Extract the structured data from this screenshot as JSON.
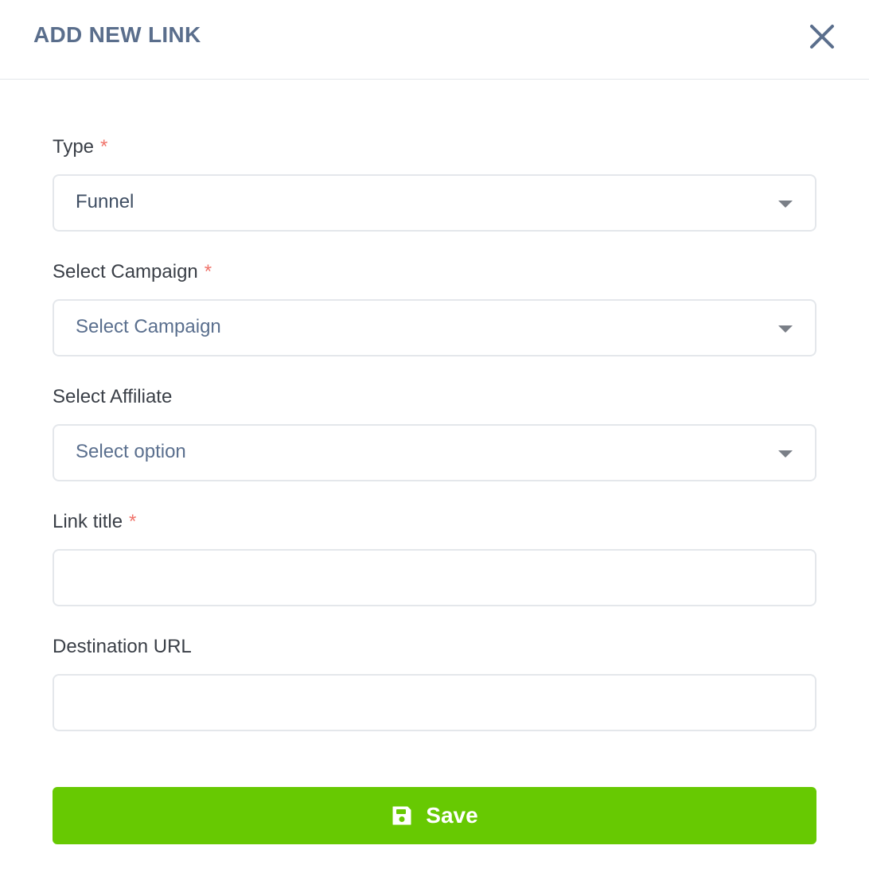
{
  "header": {
    "title": "ADD NEW LINK",
    "close_icon": "close-icon"
  },
  "form": {
    "type": {
      "label": "Type",
      "required_mark": "*",
      "value": "Funnel"
    },
    "campaign": {
      "label": "Select Campaign",
      "required_mark": "*",
      "placeholder": "Select Campaign"
    },
    "affiliate": {
      "label": "Select Affiliate",
      "placeholder": "Select option"
    },
    "link_title": {
      "label": "Link title",
      "required_mark": "*",
      "value": ""
    },
    "destination_url": {
      "label": "Destination URL",
      "value": ""
    }
  },
  "actions": {
    "save_label": "Save",
    "save_icon": "floppy-disk-icon"
  },
  "colors": {
    "title": "#5a6e8c",
    "required": "#f0736a",
    "primary": "#67c902",
    "border": "#e4e7eb"
  }
}
